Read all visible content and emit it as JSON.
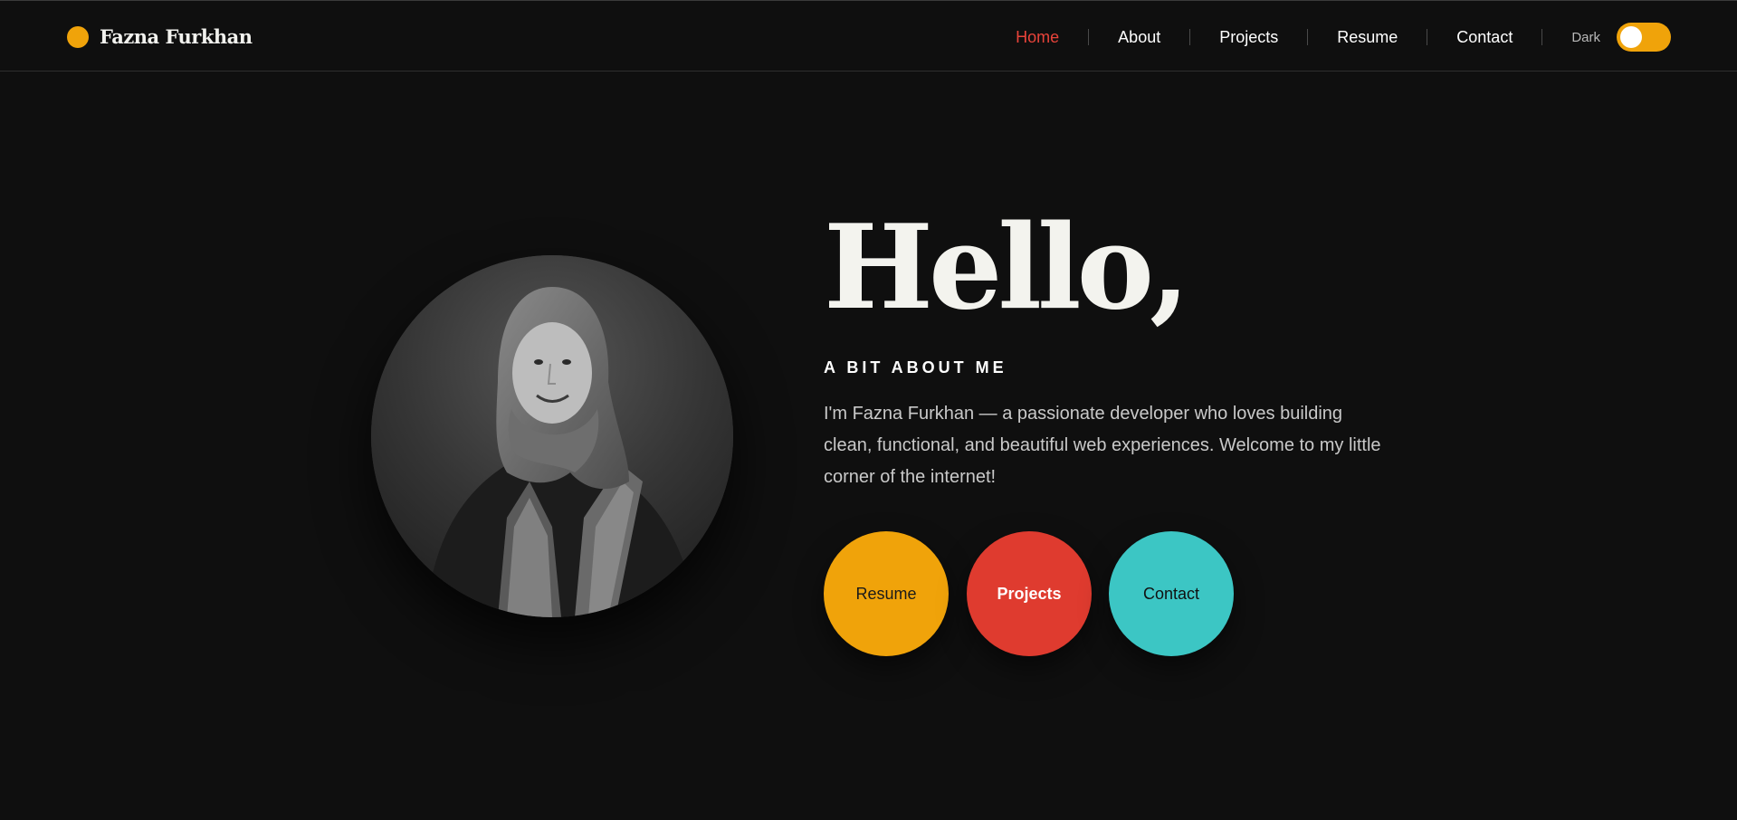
{
  "brand": {
    "name": "Fazna Furkhan",
    "dot_color": "#f0a30a"
  },
  "nav": {
    "items": [
      {
        "label": "Home",
        "active": true
      },
      {
        "label": "About",
        "active": false
      },
      {
        "label": "Projects",
        "active": false
      },
      {
        "label": "Resume",
        "active": false
      },
      {
        "label": "Contact",
        "active": false
      }
    ],
    "theme_label": "Dark",
    "theme_toggle_on": true
  },
  "hero": {
    "greeting": "Hello,",
    "section_title": "A BIT ABOUT ME",
    "bio": "I'm Fazna Furkhan — a passionate developer who loves building clean, functional, and beautiful web experiences. Welcome to my little corner of the internet!",
    "buttons": [
      {
        "label": "Resume",
        "color": "#f0a30a"
      },
      {
        "label": "Projects",
        "color": "#df3b2f"
      },
      {
        "label": "Contact",
        "color": "#3cc6c4"
      }
    ]
  },
  "colors": {
    "background": "#0f0f0f",
    "accent": "#f0a30a",
    "active_link": "#e8433a"
  },
  "icons": {
    "portrait": "profile-photo"
  }
}
